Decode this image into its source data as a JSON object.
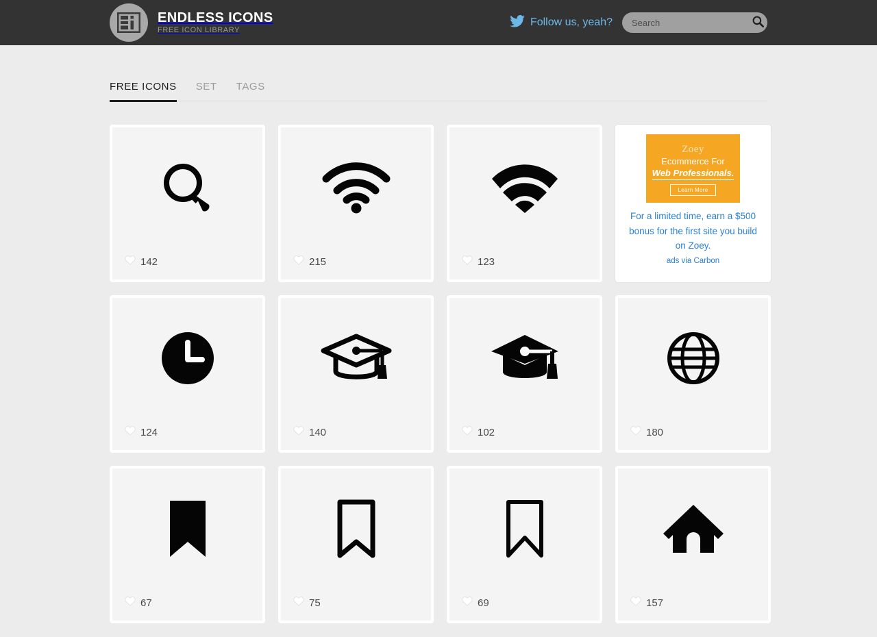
{
  "header": {
    "logo_icon": "ei-monogram-icon",
    "brand_title": "ENDLESS ICONS",
    "brand_subtitle": "FREE ICON LIBRARY",
    "twitter_icon": "twitter-bird-icon",
    "twitter_label": "Follow us, yeah?",
    "search_placeholder": "Search",
    "search_value": "",
    "search_icon": "search-icon",
    "background_color": "#333333",
    "accent_color": "#6cb8e8"
  },
  "tabs": [
    {
      "label": "FREE ICONS",
      "active": true
    },
    {
      "label": "SET",
      "active": false
    },
    {
      "label": "TAGS",
      "active": false
    }
  ],
  "grid": {
    "heart_icon": "heart-icon",
    "cards": [
      {
        "icon": "magnifier-icon",
        "count": "142"
      },
      {
        "icon": "wifi-outline-icon",
        "count": "215"
      },
      {
        "icon": "wifi-solid-icon",
        "count": "123"
      },
      {
        "icon": "clock-icon",
        "count": "124"
      },
      {
        "icon": "graduation-cap-outline-icon",
        "count": "140"
      },
      {
        "icon": "graduation-cap-solid-icon",
        "count": "102"
      },
      {
        "icon": "globe-icon",
        "count": "180"
      },
      {
        "icon": "bookmark-solid-icon",
        "count": "67"
      },
      {
        "icon": "bookmark-outline-icon",
        "count": "75"
      },
      {
        "icon": "bookmark-outline-thin-icon",
        "count": "69"
      },
      {
        "icon": "home-icon",
        "count": "157"
      }
    ]
  },
  "ad": {
    "brand": "Zoey",
    "headline_line1": "Ecommerce For",
    "headline_line2": "Web Professionals.",
    "button_label": "Learn More",
    "body": "For a limited time, earn a $500 bonus for the first site you build on Zoey.",
    "via": "ads via Carbon",
    "banner_color": "#f5a623",
    "link_color": "#2a7fd4"
  }
}
